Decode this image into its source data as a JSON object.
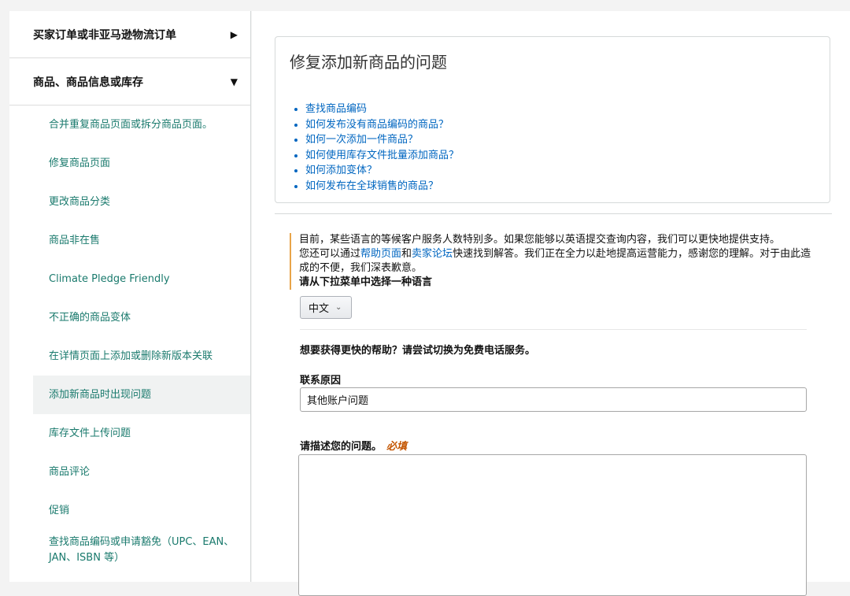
{
  "sidebar": {
    "categories": [
      {
        "label": "买家订单或非亚马逊物流订单",
        "arrow": "▶"
      },
      {
        "label": "商品、商品信息或库存",
        "arrow": "▼"
      }
    ],
    "items": [
      "合并重复商品页面或拆分商品页面。",
      "修复商品页面",
      "更改商品分类",
      "商品非在售",
      "Climate Pledge Friendly",
      "不正确的商品变体",
      "在详情页面上添加或删除新版本关联",
      "添加新商品时出现问题",
      "库存文件上传问题",
      "商品评论",
      "促销",
      "查找商品编码或申请豁免（UPC、EAN、JAN、ISBN 等）"
    ]
  },
  "card": {
    "title": "修复添加新商品的问题",
    "links": [
      "查找商品编码",
      "如何发布没有商品编码的商品？",
      "如何一次添加一件商品？",
      "如何使用库存文件批量添加商品？",
      "如何添加变体？",
      "如何发布在全球销售的商品？"
    ]
  },
  "notice": {
    "line1": "目前，某些语言的等候客户服务人数特别多。如果您能够以英语提交查询内容，我们可以更快地提供支持。",
    "line2_pre": "您还可以通过",
    "help_link": "帮助页面",
    "and": "和",
    "forum_link": "卖家论坛",
    "line2_post": "快速找到解答。我们正在全力以赴地提高运营能力，感谢您的理解。对于由此造成的不便，我们深表歉意。",
    "lang_label": "请从下拉菜单中选择一种语言"
  },
  "language": {
    "selected": "中文"
  },
  "form": {
    "faster_help": "想要获得更快的帮助？请尝试切换为免费电话服务。",
    "reason_label": "联系原因",
    "reason_value": "其他账户问题",
    "desc_label": "请描述您的问题。",
    "required": "必填"
  },
  "colors": {
    "link": "#0066c0",
    "sidebar_link": "#1a7a6d",
    "required": "#c45500",
    "notice_border": "#e8a449"
  }
}
